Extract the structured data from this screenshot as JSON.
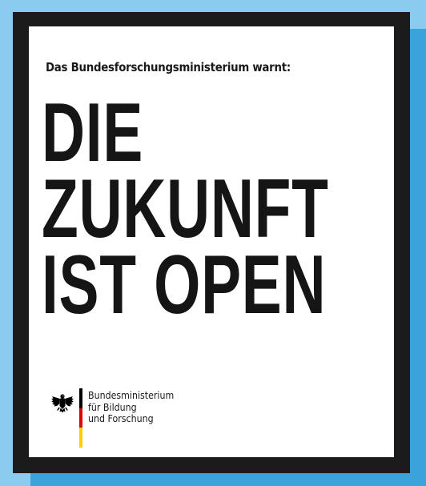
{
  "colors": {
    "background": "#8ccbf0",
    "shadow": "#3aa3dc",
    "frame": "#1b1b1b",
    "card": "#ffffff",
    "flag_black": "#000000",
    "flag_red": "#dd0000",
    "flag_gold": "#ffce00"
  },
  "poster": {
    "kicker": "Das Bundesforschungsministerium warnt:",
    "headline_lines": [
      "DIE",
      "ZUKUNFT",
      "IST OPEN"
    ]
  },
  "logo": {
    "icon": "federal-eagle-icon",
    "name_lines": [
      "Bundesministerium",
      "für Bildung",
      "und Forschung"
    ]
  }
}
